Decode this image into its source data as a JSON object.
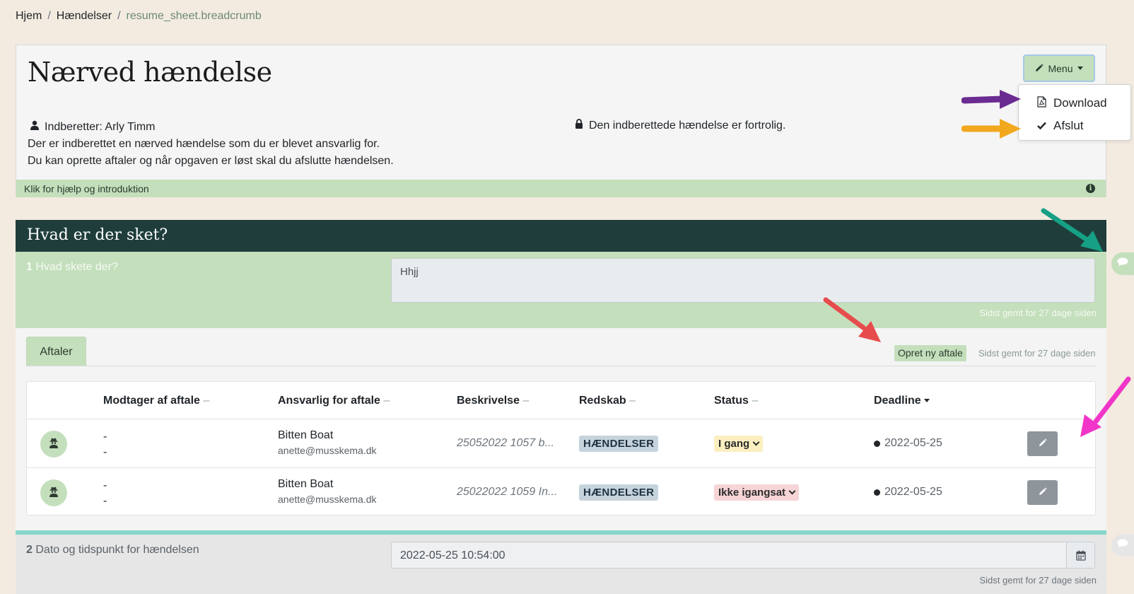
{
  "breadcrumb": {
    "home": "Hjem",
    "events": "Hændelser",
    "current": "resume_sheet.breadcrumb"
  },
  "header": {
    "title": "Nærved hændelse",
    "menu_label": "Menu",
    "reporter": "Indberetter: Arly Timm",
    "line1": "Der er indberettet en nærved hændelse som du er blevet ansvarlig for.",
    "line2": "Du kan oprette aftaler og når opgaven er løst skal du afslutte hændelsen.",
    "confidential": "Den indberettede hændelse er fortrolig.",
    "help": "Klik for hjælp og introduktion"
  },
  "dropdown": {
    "download": "Download",
    "finish": "Afslut"
  },
  "section": {
    "title": "Hvad er der sket?"
  },
  "q1": {
    "num": "1",
    "label": "Hvad skete der?",
    "answer": "Hhjj",
    "saved": "Sidst gemt for 27 dage siden"
  },
  "agreements": {
    "tab": "Aftaler",
    "new_button": "Opret ny aftale",
    "saved": "Sidst gemt for 27 dage siden",
    "columns": [
      "Modtager af aftale",
      "Ansvarlig for aftale",
      "Beskrivelse",
      "Redskab",
      "Status",
      "Deadline"
    ],
    "rows": [
      {
        "recv1": "-",
        "recv2": "-",
        "resp_name": "Bitten Boat",
        "resp_mail": "anette@musskema.dk",
        "desc": "25052022 1057 b...",
        "tool": "HÆNDELSER",
        "status": "I gang",
        "deadline": "2022-05-25"
      },
      {
        "recv1": "-",
        "recv2": "-",
        "resp_name": "Bitten Boat",
        "resp_mail": "anette@musskema.dk",
        "desc": "25022022 1059 In...",
        "tool": "HÆNDELSER",
        "status": "Ikke igangsat",
        "deadline": "2022-05-25"
      }
    ]
  },
  "q2": {
    "num": "2",
    "label": "Dato og tidspunkt for hændelsen",
    "value": "2022-05-25 10:54:00",
    "saved": "Sidst gemt for 27 dage siden"
  },
  "colors": {
    "green": "#c4dfbc",
    "dark_teal": "#1e3d3b",
    "arrow_purple": "#6a2c91",
    "arrow_orange": "#f2a81d",
    "arrow_teal": "#16a085",
    "arrow_red": "#e74c4c",
    "arrow_pink": "#f035c8"
  }
}
